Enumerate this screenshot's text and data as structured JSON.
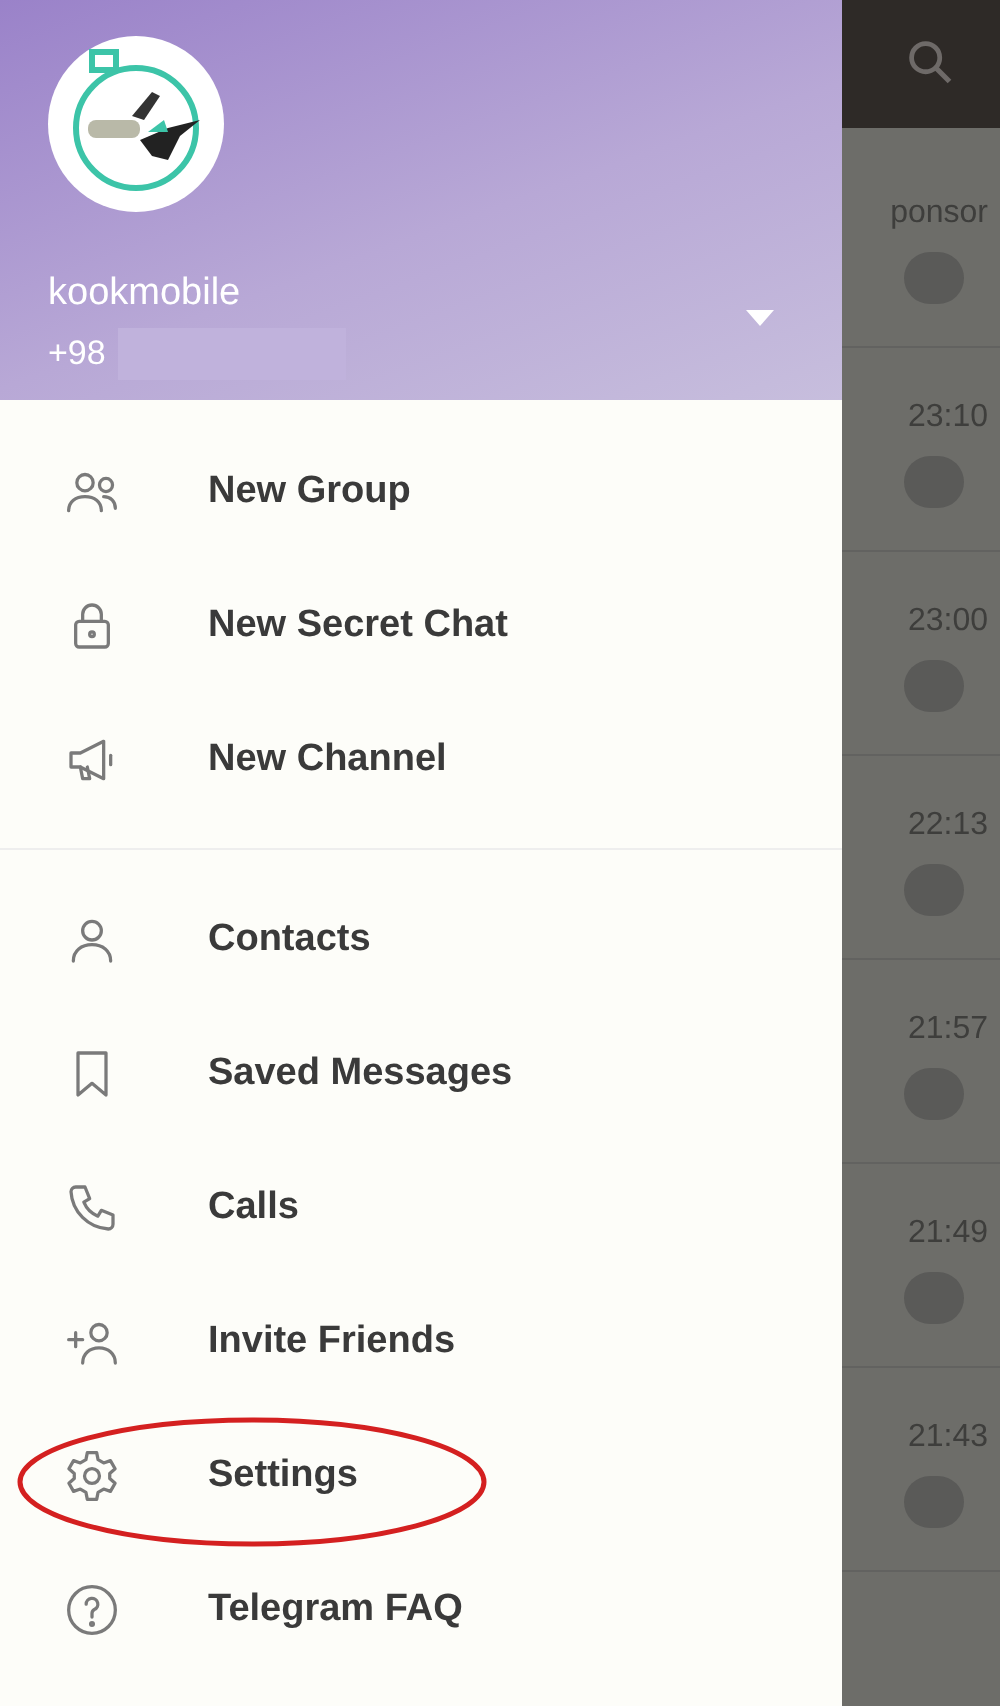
{
  "drawer": {
    "header": {
      "name": "kookmobile",
      "phone": "+98",
      "phone_hidden": true
    },
    "menu_sections": [
      [
        {
          "label": "New Group",
          "circled": false
        },
        {
          "label": "New Secret Chat",
          "circled": false
        },
        {
          "label": "New Channel",
          "circled": false
        }
      ],
      [
        {
          "label": "Contacts",
          "circled": false
        },
        {
          "label": "Saved Messages",
          "circled": false
        },
        {
          "label": "Calls",
          "circled": false
        },
        {
          "label": "Invite Friends",
          "circled": false
        },
        {
          "label": "Settings",
          "circled": true
        },
        {
          "label": "Telegram FAQ",
          "circled": false
        }
      ]
    ]
  },
  "chat_list": {
    "rows": [
      {
        "text": "ponsor"
      },
      {
        "text": "23:10"
      },
      {
        "text": "23:00"
      },
      {
        "text": "22:13"
      },
      {
        "text": "21:57"
      },
      {
        "text": "21:49"
      },
      {
        "text": "21:43"
      }
    ]
  }
}
